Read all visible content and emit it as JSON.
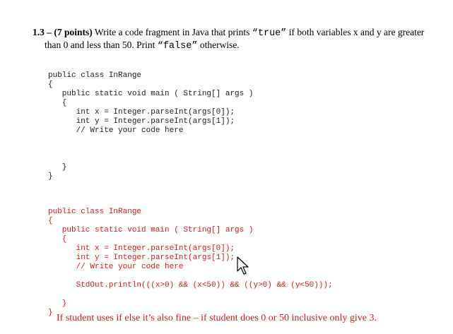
{
  "question": {
    "number": "1.3 – ",
    "points": "(7 points)",
    "text_before_true": " Write a code fragment in Java that prints ",
    "true_literal": "“true”",
    "text_after_true": " if both variables x and y are greater",
    "line2_before_false": "than 0 and less than 50.  Print ",
    "false_literal": "“false”",
    "line2_after_false": " otherwise."
  },
  "template_code": [
    "public class InRange",
    "{",
    "   public static void main ( String[] args )",
    "   {",
    "      int x = Integer.parseInt(args[0]);",
    "      int y = Integer.parseInt(args[1]);",
    "      // Write your code here",
    "",
    "",
    "",
    "   }",
    "}"
  ],
  "answer_code": [
    "public class InRange",
    "{",
    "   public static void main ( String[] args )",
    "   {",
    "      int x = Integer.parseInt(args[0]);",
    "      int y = Integer.parseInt(args[1]);",
    "      // Write your code here",
    "",
    "      StdOut.println(((x>0) && (x<50)) && ((y>0) && (y<50)));",
    "",
    "   }",
    "}"
  ],
  "grading_note": "If student uses if else it’s also fine – if student does 0 or 50 inclusive only give 3.",
  "colors": {
    "answer_text": "#d21e1e",
    "code_text": "#222222"
  }
}
